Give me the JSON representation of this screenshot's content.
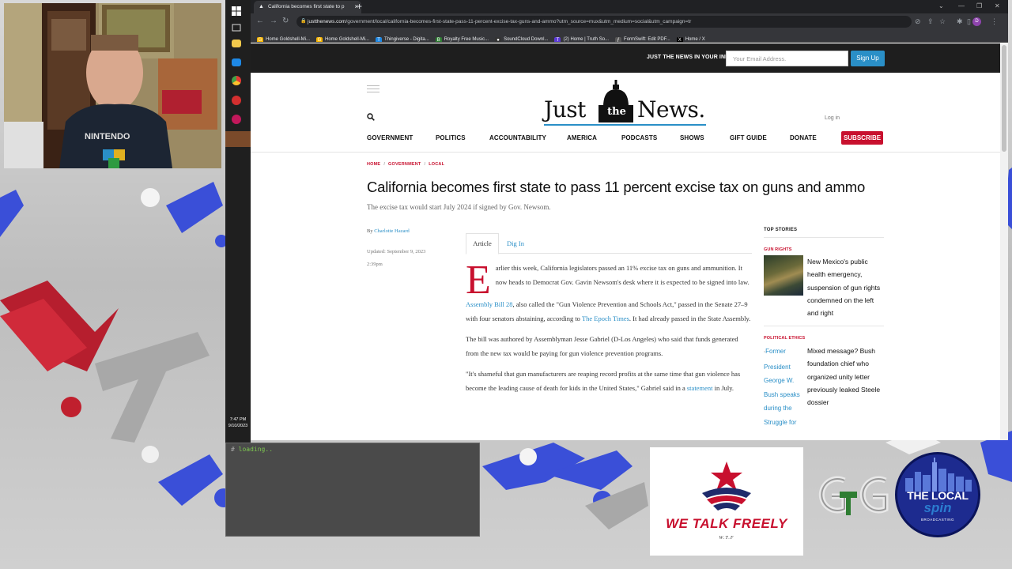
{
  "browser": {
    "tab_title": "California becomes first state to p",
    "tab_close": "×",
    "new_tab": "+",
    "url_domain": "justthenews.com",
    "url_path": "/government/local/california-becomes-first-state-pass-11-percent-excise-tax-guns-and-ammo?utm_source=mux&utm_medium=social&utm_campaign=tr",
    "profile_initial": "D",
    "bookmarks": [
      {
        "label": "Home Goldshell-Mi...",
        "icon": "G",
        "color": "#f4b400"
      },
      {
        "label": "Home Goldshell-Mi...",
        "icon": "G",
        "color": "#f4b400"
      },
      {
        "label": "Thingiverse - Digita...",
        "icon": "T",
        "color": "#1e88e5"
      },
      {
        "label": "Royalty Free Music...",
        "icon": "B",
        "color": "#2e7d32"
      },
      {
        "label": "SoundCloud Downl...",
        "icon": "●",
        "color": "#333333"
      },
      {
        "label": "(2) Home | Truth So...",
        "icon": "T",
        "color": "#5c3bd6"
      },
      {
        "label": "FormSwift: Edit PDF...",
        "icon": "ƒ",
        "color": "#555555"
      },
      {
        "label": "Home / X",
        "icon": "X",
        "color": "#000000"
      }
    ]
  },
  "taskbar": {
    "time": "7:47 PM",
    "date": "9/10/2023"
  },
  "site": {
    "newsletter_label": "JUST THE NEWS IN YOUR INBOX",
    "email_placeholder": "Your Email Address.",
    "signup_label": "Sign Up",
    "logo_word1": "Just",
    "logo_the": "the",
    "logo_word2": "News.",
    "login_label": "Log in",
    "nav": [
      "GOVERNMENT",
      "POLITICS",
      "ACCOUNTABILITY",
      "AMERICA",
      "PODCASTS",
      "SHOWS",
      "GIFT GUIDE",
      "DONATE"
    ],
    "subscribe_label": "SUBSCRIBE"
  },
  "article": {
    "breadcrumb": [
      "HOME",
      "GOVERNMENT",
      "LOCAL"
    ],
    "title": "California becomes first state to pass 11 percent excise tax on guns and ammo",
    "subtitle": "The excise tax would start July 2024 if signed by Gov. Newsom.",
    "byline_prefix": "By",
    "author": "Charlotte Hazard",
    "updated": "Updated: September 9, 2023",
    "updated_time": "2:39pm",
    "tab_article": "Article",
    "tab_digin": "Dig In",
    "drop_cap": "E",
    "p1": "arlier this week, California legislators passed an 11% excise tax on guns and ammunition. It now heads to Democrat Gov. Gavin Newsom's desk where it is expected to be signed into law.",
    "p2_link": "Assembly Bill 28",
    "p2_text": ", also called the \"Gun Violence Prevention and Schools Act,\" passed in the Senate 27–9 with four senators abstaining, according to ",
    "p2_link2": "The Epoch Times",
    "p2_end": ". It had already passed in the State Assembly.",
    "p3": "The bill was authored by Assemblyman Jesse Gabriel (D-Los Angeles) who said that funds generated from the new tax would be paying for gun violence prevention programs.",
    "p4": "\"It's shameful that gun manufacturers are reaping record profits at the same time that gun violence has become the leading cause of death for kids in the United States,\" Gabriel said in a ",
    "p4_link": "statement",
    "p4_end": " in July."
  },
  "sidebar": {
    "label": "TOP STORIES",
    "stories": [
      {
        "category": "GUN RIGHTS",
        "title": "New Mexico's public health emergency, suspension of gun rights condemned on the left and right"
      },
      {
        "category": "POLITICAL ETHICS",
        "title": "Mixed message? Bush foundation chief who organized unity letter previously leaked Steele dossier",
        "image_alt": "Former President George W. Bush speaks during the Struggle for"
      }
    ]
  },
  "terminal": {
    "prompt": "#",
    "text": "loading.."
  },
  "overlay": {
    "wtf_title": "WE TALK FREELY",
    "wtf_sub": "W.T.F",
    "local_title": "THE LOCAL",
    "local_spin": "spin",
    "local_broadcast": "BROADCASTING"
  },
  "colors": {
    "brand_red": "#c8102e",
    "brand_blue": "#2a8fc7",
    "stream_blue": "#3a4fd8",
    "stream_red": "#cc2233"
  }
}
